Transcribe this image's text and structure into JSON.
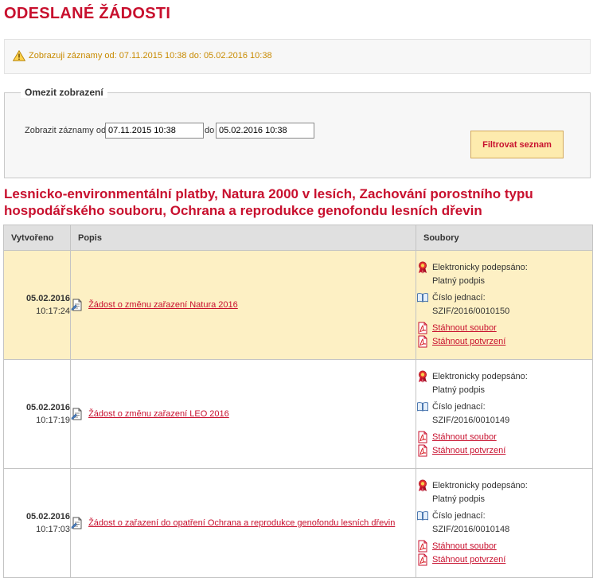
{
  "page": {
    "title": "ODESLANÉ ŽÁDOSTI"
  },
  "info": {
    "message": "Zobrazuji záznamy od: 07.11.2015 10:38 do: 05.02.2016 10:38"
  },
  "filter": {
    "legend": "Omezit zobrazení",
    "label": "Zobrazit záznamy od",
    "date_from": "07.11.2015 10:38",
    "to_label": "do",
    "date_to": "05.02.2016 10:38",
    "button_label": "Filtrovat seznam"
  },
  "section": {
    "title": "Lesnicko-environmentální platby, Natura 2000 v lesích, Zachování porostního typu hospodářského souboru, Ochrana a reprodukce genofondu lesních dřevin"
  },
  "table": {
    "headers": {
      "created": "Vytvořeno",
      "description": "Popis",
      "files": "Soubory"
    },
    "rows": [
      {
        "date": "05.02.2016",
        "time": "10:17:24",
        "description": "Žádost o změnu zařazení Natura 2016",
        "signed_label": "Elektronicky podepsáno:",
        "signed_value": "Platný podpis",
        "ref_label": "Číslo jednací:",
        "ref_value": "SZIF/2016/0010150",
        "download_file": "Stáhnout soubor",
        "download_confirmation": "Stáhnout potvrzení"
      },
      {
        "date": "05.02.2016",
        "time": "10:17:19",
        "description": "Žádost o změnu zařazení LEO 2016",
        "signed_label": "Elektronicky podepsáno:",
        "signed_value": "Platný podpis",
        "ref_label": "Číslo jednací:",
        "ref_value": "SZIF/2016/0010149",
        "download_file": "Stáhnout soubor",
        "download_confirmation": "Stáhnout potvrzení"
      },
      {
        "date": "05.02.2016",
        "time": "10:17:03",
        "description": "Žádost o zařazení do opatření Ochrana a reprodukce genofondu lesních dřevin",
        "signed_label": "Elektronicky podepsáno:",
        "signed_value": "Platný podpis",
        "ref_label": "Číslo jednací:",
        "ref_value": "SZIF/2016/0010148",
        "download_file": "Stáhnout soubor",
        "download_confirmation": "Stáhnout potvrzení"
      }
    ]
  },
  "colors": {
    "accent": "#c8102e",
    "warning_text": "#c88a00",
    "highlight_row": "#fdf0c4",
    "header_bg": "#e0e0e0",
    "button_bg": "#fdebae"
  }
}
